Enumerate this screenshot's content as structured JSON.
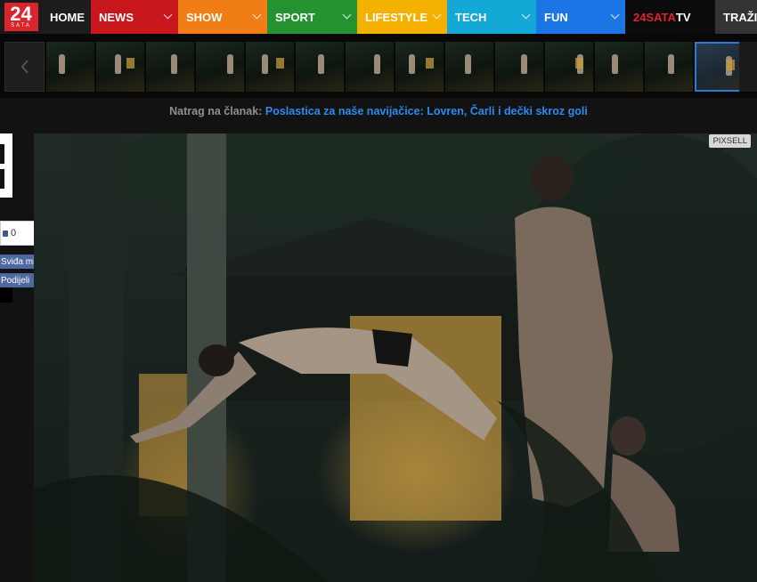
{
  "logo": {
    "number": "24",
    "sub": "SATA"
  },
  "nav": {
    "home": "HOME",
    "news": "NEWS",
    "show": "SHOW",
    "sport": "SPORT",
    "lifestyle": "LIFESTYLE",
    "tech": "TECH",
    "fun": "FUN",
    "tv_prefix": "24SATA",
    "tv_suffix": "TV",
    "search": "TRAŽI"
  },
  "colors": {
    "news": "#c8161d",
    "show": "#f07d16",
    "sport": "#24932f",
    "lifestyle": "#f5b100",
    "tech": "#14a8d6",
    "fun": "#1b75e4",
    "link": "#2c8af0"
  },
  "gallery": {
    "thumb_count": 14,
    "active_index": 13
  },
  "back_link": {
    "label": "Natrag na članak:",
    "title": "Poslastica za naše navijačice: Lovren, Čarli i dečki skroz goli"
  },
  "social": {
    "like_count": "0",
    "like_label": "Sviđa mi se",
    "share_label": "Podijeli"
  },
  "photo": {
    "credit": "PIXSELL"
  }
}
